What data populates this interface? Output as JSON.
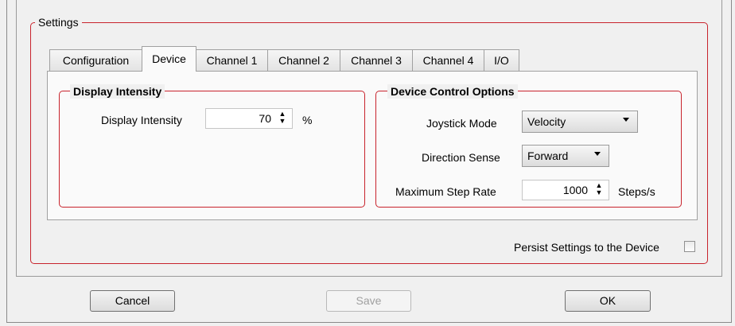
{
  "settings": {
    "legend": "Settings",
    "tabs": [
      "Configuration",
      "Device",
      "Channel 1",
      "Channel 2",
      "Channel 3",
      "Channel 4",
      "I/O"
    ],
    "active_tab": "Device"
  },
  "display_intensity": {
    "group_title": "Display Intensity",
    "label": "Display Intensity",
    "value": "70",
    "unit": "%"
  },
  "device_control": {
    "group_title": "Device Control Options",
    "joystick_mode_label": "Joystick Mode",
    "joystick_mode_value": "Velocity",
    "direction_sense_label": "Direction Sense",
    "direction_sense_value": "Forward",
    "max_step_rate_label": "Maximum Step Rate",
    "max_step_rate_value": "1000",
    "max_step_rate_unit": "Steps/s"
  },
  "persist": {
    "label": "Persist Settings to the Device",
    "checked": false
  },
  "buttons": {
    "cancel": "Cancel",
    "save": "Save",
    "ok": "OK"
  },
  "icons": {
    "spin": "up-down-chevron-icon",
    "dropdown": "chevron-down-icon"
  }
}
